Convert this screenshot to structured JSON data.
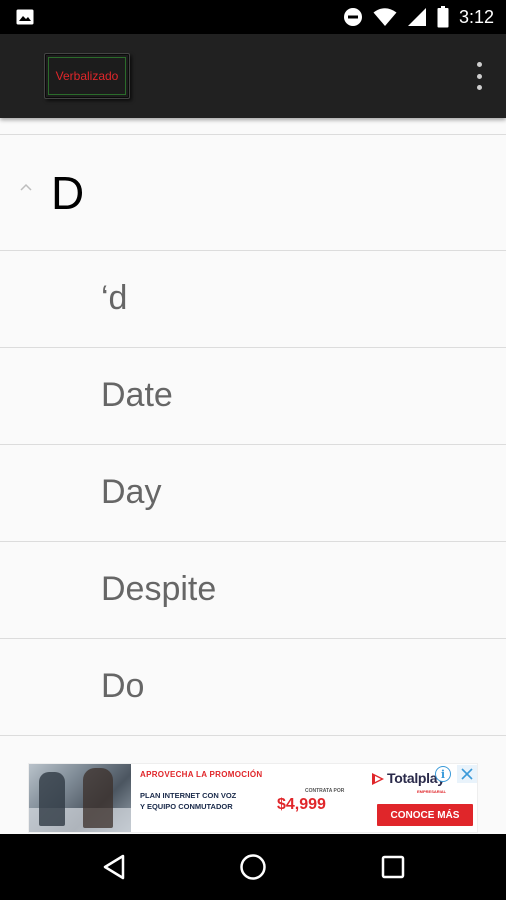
{
  "status_bar": {
    "time": "3:12",
    "left_icons": [
      "image-icon"
    ],
    "right_icons": [
      "do-not-disturb-icon",
      "wifi-icon",
      "cell-signal-icon",
      "battery-icon"
    ]
  },
  "app_bar": {
    "logo_text": "Verbalizado",
    "menu_icon": "overflow-menu-icon"
  },
  "group": {
    "letter": "D",
    "expanded": true,
    "chevron_icon": "chevron-up-icon"
  },
  "items": [
    {
      "label": "‘d"
    },
    {
      "label": "Date"
    },
    {
      "label": "Day"
    },
    {
      "label": "Despite"
    },
    {
      "label": "Do"
    }
  ],
  "ad": {
    "headline": "APROVECHA LA PROMOCIÓN",
    "offer_line_1": "PLAN INTERNET CON VOZ",
    "offer_line_2": "Y EQUIPO CONMUTADOR",
    "contrata": "CONTRATA POR",
    "price": "$4,999",
    "brand": "Totalplay",
    "brand_sub": "EMPRESARIAL",
    "cta": "CONOCE MÁS",
    "info_icon": "i"
  },
  "nav_bar": {
    "buttons": [
      "back-icon",
      "home-icon",
      "recents-icon"
    ]
  },
  "colors": {
    "status_bar_bg": "#000000",
    "app_bar_bg": "#212121",
    "logo_text": "#e0262a",
    "list_bg": "#fafafa",
    "divider": "#dcdcdc",
    "item_text": "#666666",
    "ad_accent": "#e0262a"
  }
}
